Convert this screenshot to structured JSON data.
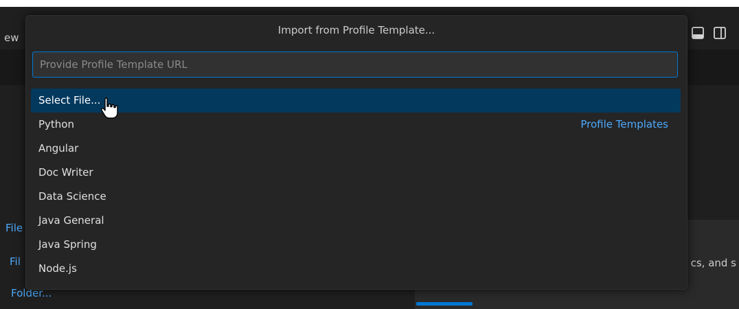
{
  "window": {
    "menu_fragment": "ew"
  },
  "background": {
    "links": [
      "File",
      "Fil",
      "Folder..."
    ],
    "desc_fragment": "cs, and s"
  },
  "quick_pick": {
    "title": "Import from Profile Template...",
    "input": {
      "placeholder": "Provide Profile Template URL",
      "value": ""
    },
    "group_label": "Profile Templates",
    "items": [
      {
        "label": "Select File...",
        "selected": true
      },
      {
        "label": "Python",
        "selected": false
      },
      {
        "label": "Angular",
        "selected": false
      },
      {
        "label": "Doc Writer",
        "selected": false
      },
      {
        "label": "Data Science",
        "selected": false
      },
      {
        "label": "Java General",
        "selected": false
      },
      {
        "label": "Java Spring",
        "selected": false
      },
      {
        "label": "Node.js",
        "selected": false
      }
    ]
  },
  "colors": {
    "accent": "#0078d4",
    "selection": "#04395e",
    "link": "#4daafc",
    "dialog_bg": "#252526"
  },
  "icons": [
    "toggle-panel-icon",
    "toggle-secondary-sidebar-icon",
    "hand-cursor-icon"
  ]
}
